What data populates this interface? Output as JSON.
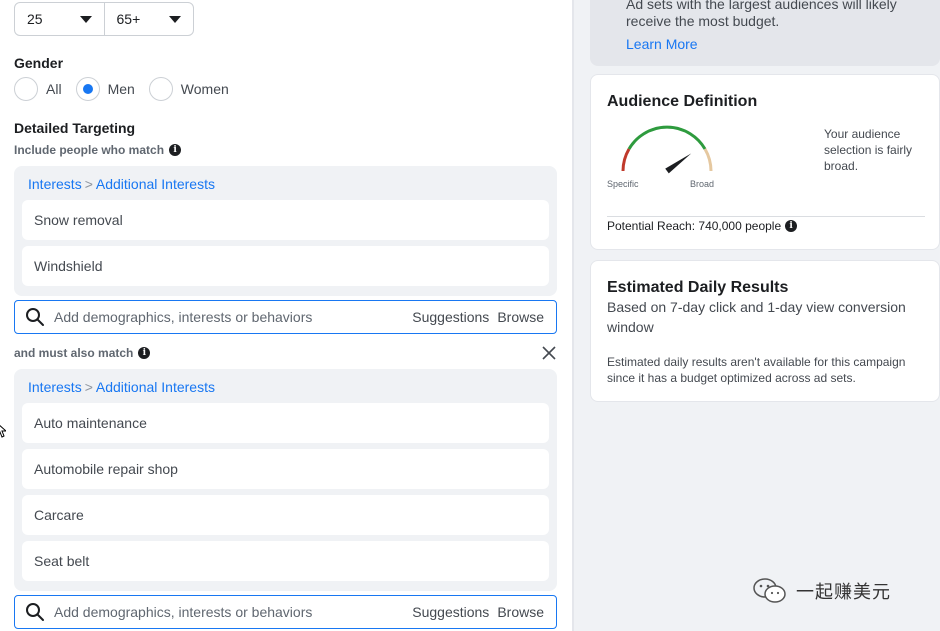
{
  "age": {
    "min": "25",
    "max": "65+"
  },
  "gender": {
    "label": "Gender",
    "options": [
      {
        "label": "All",
        "checked": false
      },
      {
        "label": "Men",
        "checked": true
      },
      {
        "label": "Women",
        "checked": false
      }
    ]
  },
  "detailed_targeting": {
    "label": "Detailed Targeting",
    "include_label": "Include people who match",
    "include_group": {
      "breadcrumb": [
        "Interests",
        "Additional Interests"
      ],
      "items": [
        "Snow removal",
        "Windshield"
      ]
    },
    "must_match_label": "and must also match",
    "must_group": {
      "breadcrumb": [
        "Interests",
        "Additional Interests"
      ],
      "items": [
        "Auto maintenance",
        "Automobile repair shop",
        "Carcare",
        "Seat belt"
      ]
    },
    "search": {
      "placeholder": "Add demographics, interests or behaviors",
      "suggestions": "Suggestions",
      "browse": "Browse"
    },
    "breadcrumb_separator": ">"
  },
  "budget_info": {
    "line1": "Ad sets with the largest audiences will likely",
    "line2": "receive the most budget.",
    "learn_more": "Learn More"
  },
  "audience_definition": {
    "title": "Audience Definition",
    "description_lines": [
      "Your audience",
      "selection is fairly",
      "broad."
    ],
    "gauge_specific": "Specific",
    "gauge_broad": "Broad",
    "gauge_level": 0.8,
    "potential_reach": "Potential Reach: 740,000 people"
  },
  "daily_results": {
    "title": "Estimated Daily Results",
    "subtitle_lines": [
      "Based on 7-day click and 1-day view conversion",
      "window"
    ],
    "note_lines": [
      "Estimated daily results aren't available for this campaign",
      "since it has a budget optimized across ad sets."
    ]
  },
  "watermark": {
    "text": "一起赚美元",
    "icon": "wechat-icon"
  },
  "colors": {
    "accent": "#1877f2",
    "gauge_green": "#2e9b3e",
    "gauge_red": "#c0392b",
    "gauge_tan": "#e5c8a0"
  }
}
